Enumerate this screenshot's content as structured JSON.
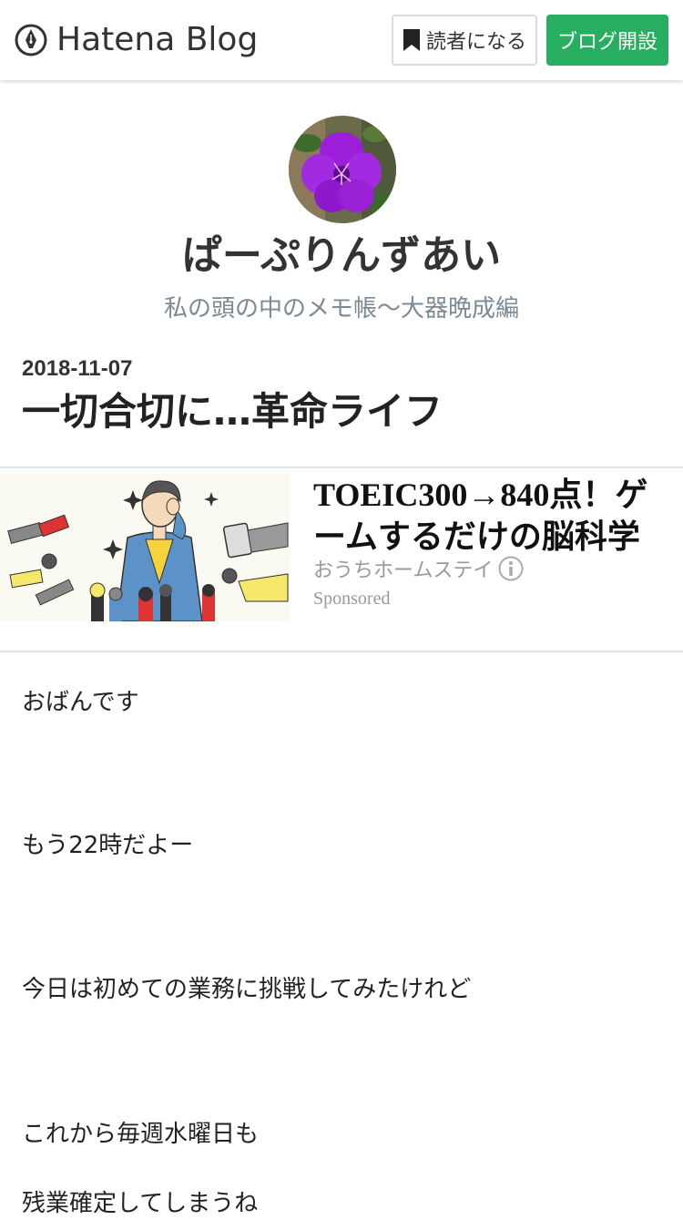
{
  "header": {
    "logo_text": "Hatena Blog",
    "follow_label": "読者になる",
    "open_blog_label": "ブログ開設"
  },
  "blog": {
    "title": "ぱーぷりんずあい",
    "description": "私の頭の中のメモ帳～大器晩成編"
  },
  "entry": {
    "date": "2018-11-07",
    "title": "一切合切に…革命ライフ"
  },
  "ad": {
    "title": "TOEIC300→840点！ゲームするだけの脳科学",
    "source": "おうちホームステイ",
    "sponsored": "Sponsored"
  },
  "body": {
    "paragraphs": [
      "おばんです",
      "もう22時だよー",
      "今日は初めての業務に挑戦してみたけれど",
      "これから毎週水曜日も",
      "残業確定してしまうね"
    ]
  },
  "colors": {
    "accent_green": "#27ae60",
    "description_gray": "#7b8a94"
  }
}
